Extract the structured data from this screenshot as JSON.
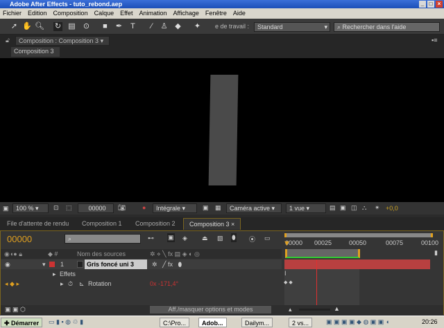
{
  "window": {
    "title": "Adobe After Effects - tuto_rebond.aep"
  },
  "menu": [
    "Fichier",
    "Edition",
    "Composition",
    "Calque",
    "Effet",
    "Animation",
    "Affichage",
    "Fenêtre",
    "Aide"
  ],
  "toolbar": {
    "workspace_label": "e de travail :",
    "workspace_value": "Standard",
    "search_placeholder": "Rechercher dans l'aide"
  },
  "comp_panel": {
    "title": "Composition : Composition 3",
    "subtab": "Composition 3"
  },
  "viewer_bar": {
    "zoom": "100 %",
    "timecode": "00000",
    "resolution": "Intégrale",
    "camera": "Caméra active",
    "views": "1 vue",
    "exposure": "+0,0"
  },
  "panel_tabs": [
    "File d'attente de rendu",
    "Composition 1",
    "Composition 2",
    "Composition 3"
  ],
  "timeline": {
    "timecode": "00000",
    "ruler": [
      "00000",
      "00025",
      "00050",
      "00075",
      "00100"
    ],
    "col_source": "Nom des sources",
    "layer": {
      "num": "1",
      "name": "Gris foncé uni 3"
    },
    "effects": "Effets",
    "property": "Rotation",
    "property_value": "0x -171,4°",
    "toggle_label": "Aff./masquer options et modes"
  },
  "taskbar": {
    "start": "Démarrer",
    "items": [
      "C:\\Pro...",
      "Adob...",
      "Dailym...",
      "2 vs..."
    ],
    "clock": "20:26"
  },
  "colors": {
    "accent": "#e0a020",
    "layer_bar": "#b84040",
    "playhead": "#e03030"
  }
}
